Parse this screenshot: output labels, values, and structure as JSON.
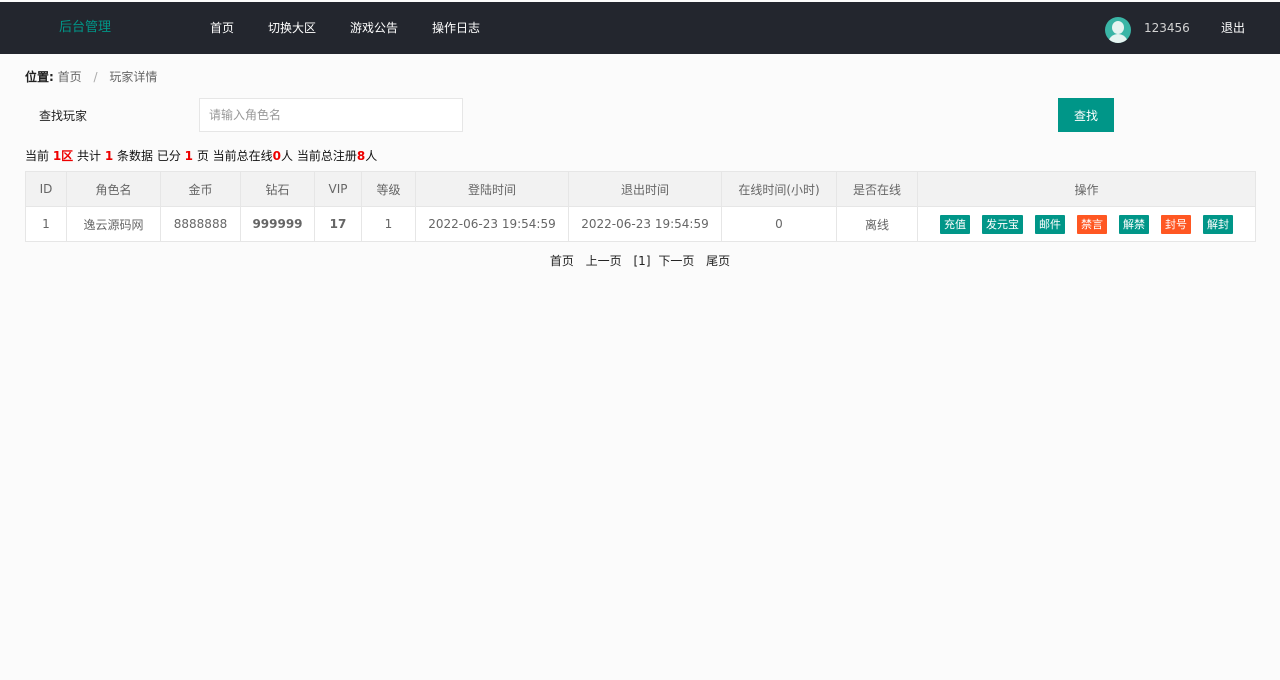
{
  "header": {
    "logo": "后台管理",
    "nav": [
      "首页",
      "切换大区",
      "游戏公告",
      "操作日志"
    ],
    "username": "123456",
    "logout": "退出"
  },
  "breadcrumb": {
    "label": "位置:",
    "items": [
      "首页",
      "玩家详情"
    ],
    "separator": "/"
  },
  "search": {
    "label": "查找玩家",
    "placeholder": "请输入角色名",
    "value": "",
    "button": "查找"
  },
  "summary": {
    "t1": "当前 ",
    "zone": "1区",
    "t2": " 共计 ",
    "total": "1",
    "t3": " 条数据 已分 ",
    "pages": "1",
    "t4": " 页 当前总在线",
    "online": "0",
    "t5": "人 当前总注册",
    "registered": "8",
    "t6": "人"
  },
  "table": {
    "headers": [
      "ID",
      "角色名",
      "金币",
      "钻石",
      "VIP",
      "等级",
      "登陆时间",
      "退出时间",
      "在线时间(小时)",
      "是否在线",
      "操作"
    ],
    "rows": [
      {
        "id": "1",
        "name": "逸云源码网",
        "gold": "8888888",
        "diamond": "999999",
        "vip": "17",
        "level": "1",
        "login_time": "2022-06-23 19:54:59",
        "logout_time": "2022-06-23 19:54:59",
        "online_hours": "0",
        "is_online": "离线",
        "actions": [
          "充值",
          "发元宝",
          "邮件",
          "禁言",
          "解禁",
          "封号",
          "解封"
        ]
      }
    ]
  },
  "pagination": {
    "first": "首页",
    "prev": "上一页",
    "current": "[1]",
    "next": "下一页",
    "last": "尾页"
  },
  "colors": {
    "header_bg": "#23262e",
    "accent": "#009688",
    "danger": "#ff5722",
    "highlight_red": "#ee0000",
    "diamond_green": "#22dd22"
  }
}
